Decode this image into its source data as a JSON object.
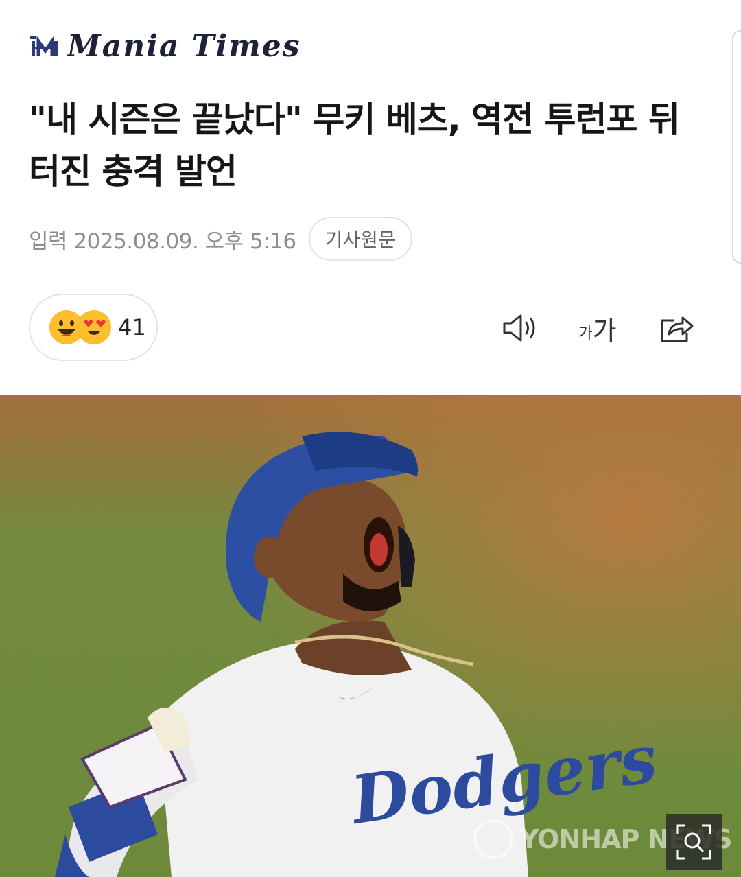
{
  "header": {
    "logo_text": "Mania Times",
    "logo_icon": "mania-times-logo"
  },
  "article": {
    "title": "\"내 시즌은 끝났다\" 무키 베츠, 역전 투런포 뒤 터진 충격 발언",
    "published_date": "입력 2025.08.09. 오후 5:16",
    "source_button": "기사원문"
  },
  "reactions": {
    "icons": [
      "smiling-face-icon",
      "heart-eyes-face-icon"
    ],
    "count": "41"
  },
  "toolbar": {
    "speaker_icon": "speaker-icon",
    "font_small": "가",
    "font_big": "가",
    "share_icon": "share-icon"
  },
  "photo": {
    "jersey_text": "Dodgers",
    "watermark_text": "YONHAP NEWS",
    "zoom_icon": "zoom-search-icon"
  },
  "colors": {
    "headline": "#161616",
    "meta": "#8e8e8e",
    "logo": "#1e2238",
    "helmet_blue": "#2d4fa3",
    "field_green": "#6f8c3c",
    "dirt_brown": "#b0773d"
  }
}
